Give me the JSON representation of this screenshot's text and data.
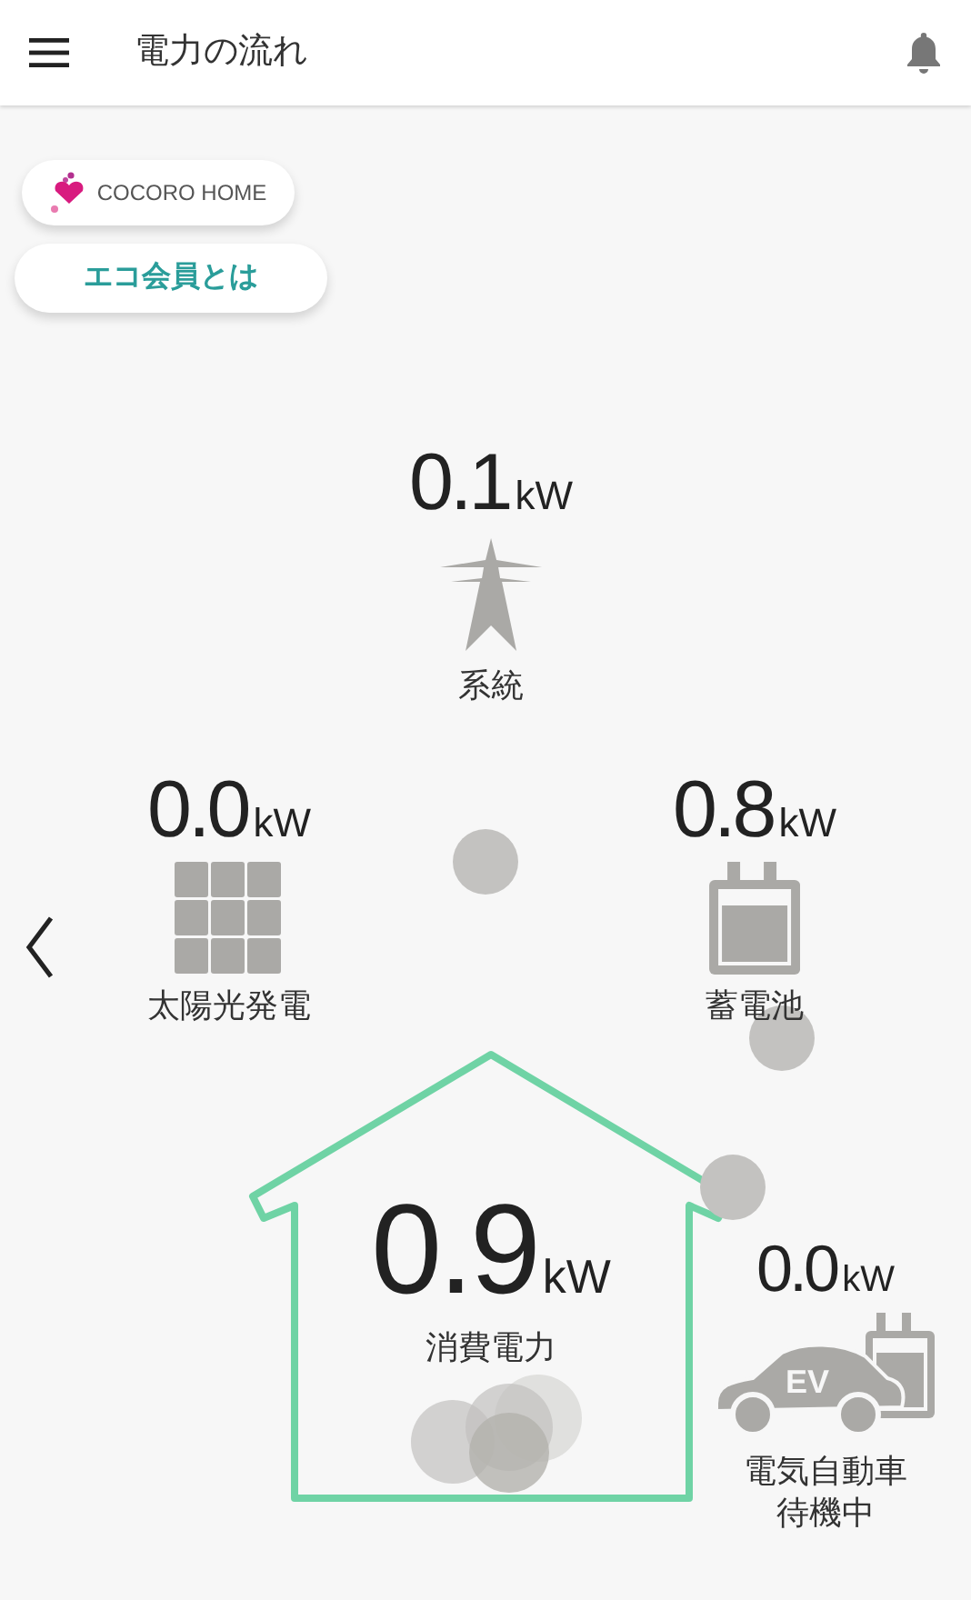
{
  "header": {
    "title": "電力の流れ"
  },
  "links": [
    {
      "kind": "logo",
      "label": "COCORO HOME"
    },
    {
      "kind": "text",
      "label": "エコ会員とは"
    }
  ],
  "nodes": [
    {
      "kind": "grid",
      "value": "0.1",
      "unit": "kW",
      "label": "系統"
    },
    {
      "kind": "solar",
      "value": "0.0",
      "unit": "kW",
      "label": "太陽光発電"
    },
    {
      "kind": "battery",
      "value": "0.8",
      "unit": "kW",
      "label": "蓄電池"
    },
    {
      "kind": "home",
      "value": "0.9",
      "unit": "kW",
      "label": "消費電力"
    },
    {
      "kind": "ev",
      "value": "0.0",
      "unit": "kW",
      "label": "電気自動車",
      "badge": "EV",
      "status": "待機中"
    }
  ]
}
